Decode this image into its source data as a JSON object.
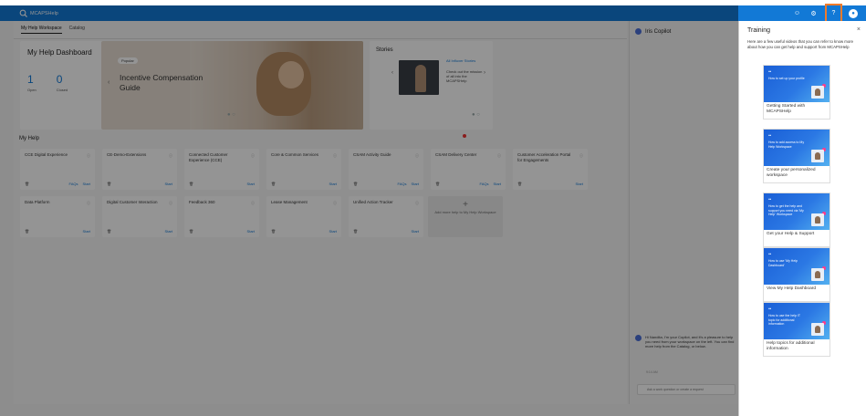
{
  "header": {
    "app_title": "MCAPSHelp",
    "icons": [
      "smiley-icon",
      "settings-icon",
      "help-icon",
      "user-avatar"
    ]
  },
  "workspace": {
    "tabs": [
      "My Help Workspace",
      "Catalog"
    ],
    "dashboard": {
      "title": "My Help Dashboard",
      "open_count": "1",
      "open_label": "Open",
      "closed_count": "0",
      "closed_label": "Closed"
    },
    "promo": {
      "tag": "Popular",
      "headline": "Incentive Compensation Guide"
    },
    "stories": {
      "title": "Stories",
      "link": "All Influxer Stories",
      "description": "Check out the mission of all into the MCAPSHelp"
    },
    "my_help_title": "My Help",
    "tiles": [
      {
        "name": "CCE Digital Experience",
        "faq": "FAQs",
        "start": "Start"
      },
      {
        "name": "CE-Demo-Extensions",
        "faq": "",
        "start": "Start"
      },
      {
        "name": "Connected Customer Experience (CCE)",
        "faq": "",
        "start": "Start"
      },
      {
        "name": "Core & Common Services",
        "faq": "",
        "start": "Start"
      },
      {
        "name": "CSAM Activity Guide",
        "faq": "FAQs",
        "start": "Start"
      },
      {
        "name": "CSAM Delivery Center",
        "faq": "FAQs",
        "start": "Start"
      },
      {
        "name": "Customer Acceleration Portal for Engagements",
        "faq": "",
        "start": "Start"
      },
      {
        "name": "Data Platform",
        "faq": "",
        "start": "Start"
      },
      {
        "name": "Digital Customer Interaction",
        "faq": "",
        "start": "Start"
      },
      {
        "name": "Feedback 360",
        "faq": "",
        "start": "Start"
      },
      {
        "name": "Lease Management",
        "faq": "",
        "start": "Start"
      },
      {
        "name": "Unified Action Tracker",
        "faq": "",
        "start": "Start"
      }
    ],
    "add_tile": "Add more help to My Help Workspace"
  },
  "copilot": {
    "title": "Iris Copilot",
    "message": "Hi Nandita, I'm your Copilot, and it's a pleasure to help you need from your workspace on the left. You can find more help from the Catalog, or below.",
    "time": "9:14 AM",
    "input_placeholder": "Ask a work question or create a request"
  },
  "training": {
    "title": "Training",
    "close": "×",
    "intro": "Here are a few useful videos that you can refer to know more about how you can get help and support from MCAPSHelp",
    "videos": [
      {
        "thumb": "How to set up your profile",
        "label": "Getting Started with MCAPSHelp"
      },
      {
        "thumb": "How to add access to My Help Workspace",
        "label": "Create your personalized workspace"
      },
      {
        "thumb": "How to get the help and support you need via 'My Help' Workspace",
        "label": "Get your Help & Support"
      },
      {
        "thumb": "How to use 'My Help Dashboard'",
        "label": "View My Help Dashboard"
      },
      {
        "thumb": "How to use the help IT topic for additional information",
        "label": "Help topics for additional information"
      }
    ]
  }
}
